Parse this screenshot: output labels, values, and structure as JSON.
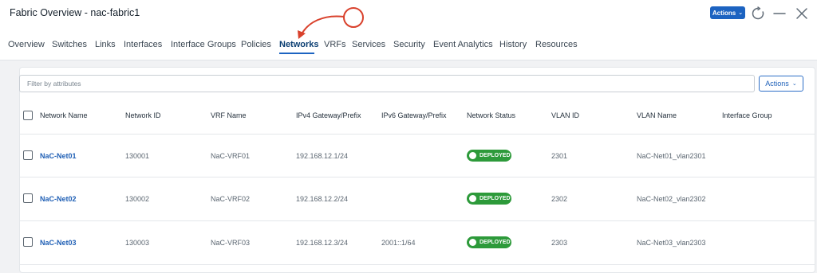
{
  "window": {
    "title": "Fabric Overview - nac-fabric1",
    "actions_label": "Actions",
    "refresh_icon": "refresh-icon",
    "minimize_icon": "minimize-icon",
    "close_icon": "close-icon"
  },
  "tabs": [
    "Overview",
    "Switches",
    "Links",
    "Interfaces",
    "Interface Groups",
    "Policies",
    "Networks",
    "VRFs",
    "Services",
    "Security",
    "Event Analytics",
    "History",
    "Resources"
  ],
  "active_tab": "Networks",
  "toolbar": {
    "filter_placeholder": "Filter by attributes",
    "filter_value": "",
    "actions_label": "Actions"
  },
  "table": {
    "columns": [
      "Network Name",
      "Network ID",
      "VRF Name",
      "IPv4 Gateway/Prefix",
      "IPv6 Gateway/Prefix",
      "Network Status",
      "VLAN ID",
      "VLAN Name",
      "Interface Group"
    ],
    "rows": [
      {
        "name": "NaC-Net01",
        "id": "130001",
        "vrf": "NaC-VRF01",
        "ipv4": "192.168.12.1/24",
        "ipv6": "",
        "status": "DEPLOYED",
        "vlan_id": "2301",
        "vlan_name": "NaC-Net01_vlan2301",
        "interface_group": ""
      },
      {
        "name": "NaC-Net02",
        "id": "130002",
        "vrf": "NaC-VRF02",
        "ipv4": "192.168.12.2/24",
        "ipv6": "",
        "status": "DEPLOYED",
        "vlan_id": "2302",
        "vlan_name": "NaC-Net02_vlan2302",
        "interface_group": ""
      },
      {
        "name": "NaC-Net03",
        "id": "130003",
        "vrf": "NaC-VRF03",
        "ipv4": "192.168.12.3/24",
        "ipv6": "2001::1/64",
        "status": "DEPLOYED",
        "vlan_id": "2303",
        "vlan_name": "NaC-Net03_vlan2303",
        "interface_group": ""
      }
    ]
  },
  "colors": {
    "accent": "#1c63c1",
    "status_deployed": "#2d9a3a",
    "annotation": "#d9412c"
  }
}
